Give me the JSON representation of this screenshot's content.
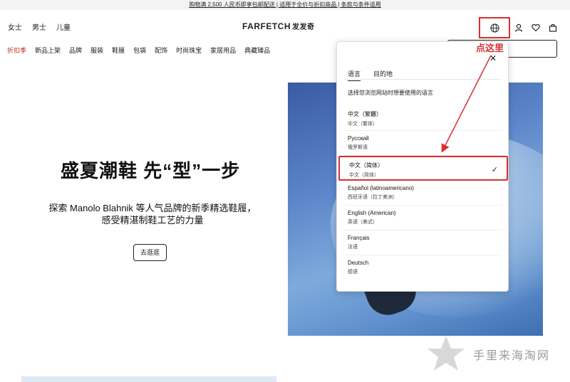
{
  "promo": "购物满 2,500 人民币即享包邮配送 | 适用于全价与折扣商品 | 条款与条件适用",
  "header": {
    "gender_tabs": [
      "女士",
      "男士",
      "儿童"
    ],
    "brand": "FARFETCH",
    "brand_cn": "发发奇"
  },
  "nav": {
    "sale": "折扣季",
    "items": [
      "新品上架",
      "品牌",
      "服装",
      "鞋履",
      "包袋",
      "配饰",
      "时尚珠宝",
      "家居用品",
      "典藏臻品"
    ]
  },
  "hero": {
    "title": "盛夏潮鞋 先“型”一步",
    "subtitle": "探索 Manolo Blahnik 等人气品牌的新季精选鞋履，感受精湛制鞋工艺的力量",
    "button": "去逛逛"
  },
  "annotation": {
    "label": "点这里",
    "color": "#d63031"
  },
  "dropdown": {
    "tabs": [
      "语言",
      "目的地"
    ],
    "prompt": "选择您浏览网站时想要使用的语言",
    "close": "✕",
    "languages": [
      {
        "name": "中文（繁體）",
        "native": "中文（繁体）"
      },
      {
        "name": "Русский",
        "native": "俄罗斯语"
      },
      {
        "name": "中文（简体）",
        "native": "中文（简体）",
        "selected": true
      },
      {
        "name": "Español (latinoamericano)",
        "native": "西班牙语（拉丁美洲）"
      },
      {
        "name": "English (American)",
        "native": "英语（美式）"
      },
      {
        "name": "Français",
        "native": "法语"
      },
      {
        "name": "Deutsch",
        "native": "德语"
      }
    ]
  },
  "watermark": "手里来海淘网",
  "icons": [
    "globe-icon",
    "user-icon",
    "heart-icon",
    "bag-icon",
    "check-icon",
    "close-icon"
  ]
}
